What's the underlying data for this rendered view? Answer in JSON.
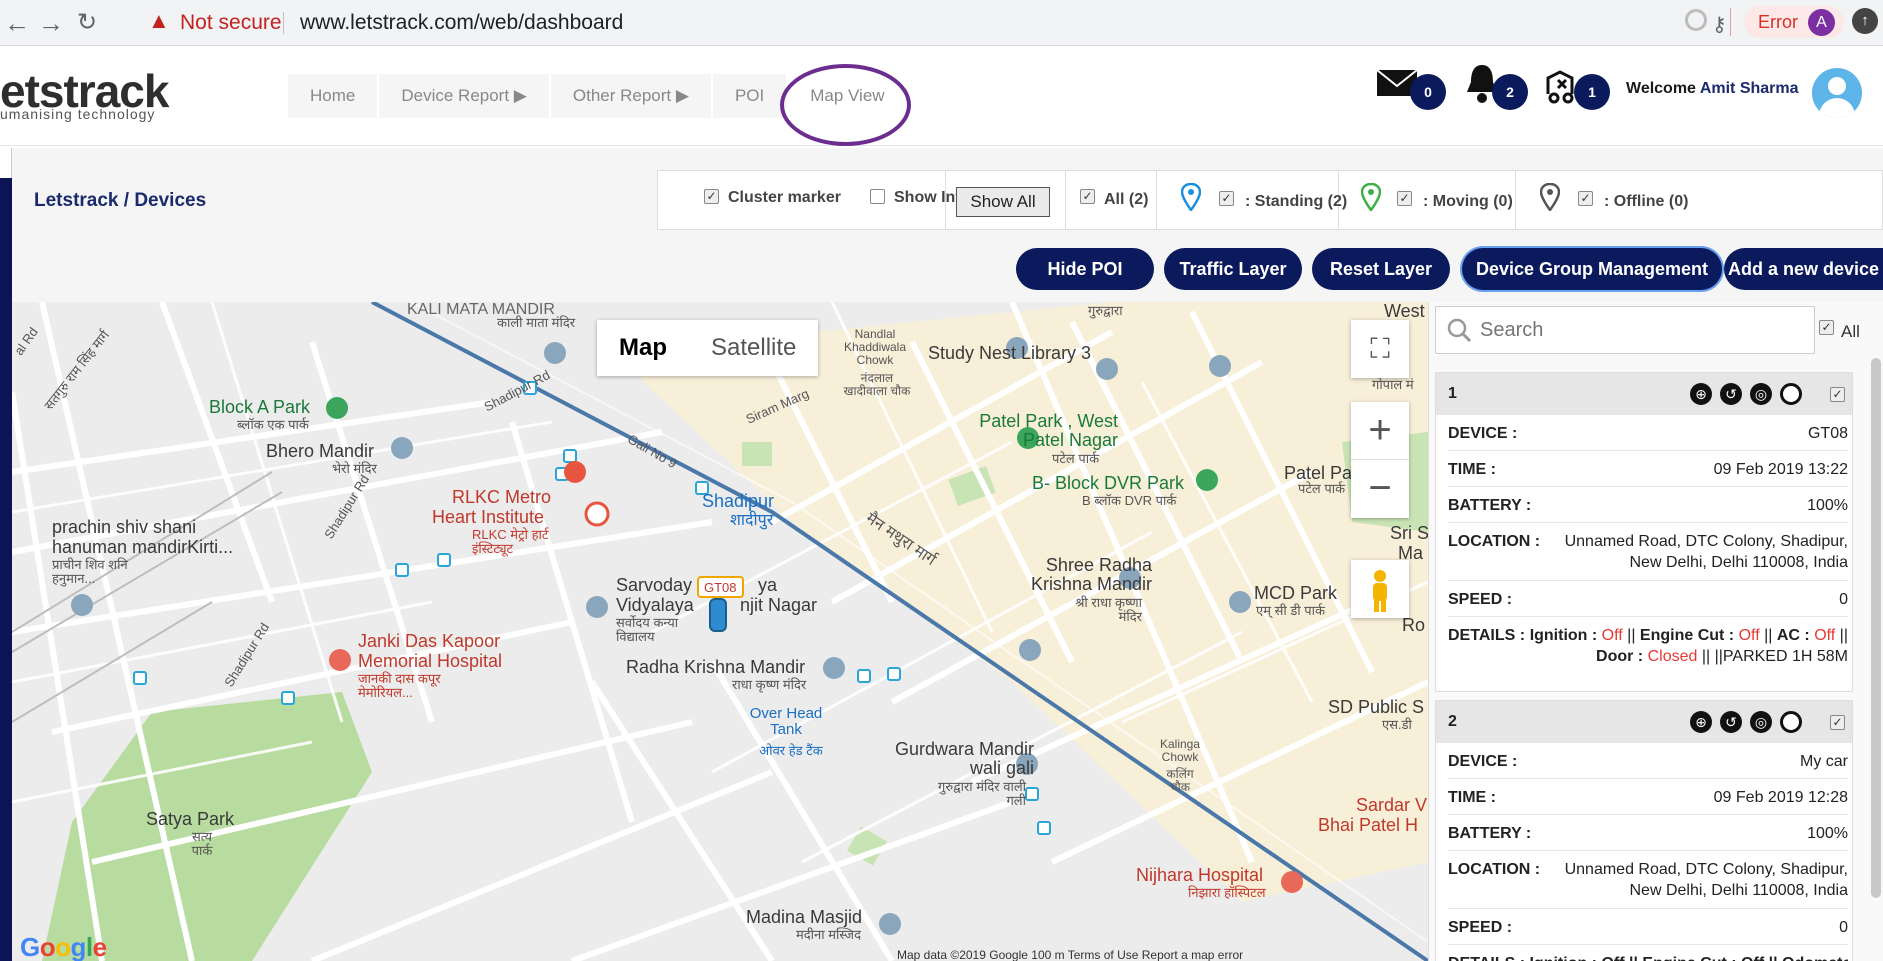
{
  "browser": {
    "not_secure": "Not secure",
    "url": "www.letstrack.com/web/dashboard",
    "error_label": "Error",
    "profile_initial": "A"
  },
  "header": {
    "logo": "etstrack",
    "tagline": "umanising technology",
    "nav": [
      "Home",
      "Device Report ▶",
      "Other Report ▶",
      "POI",
      "Map View"
    ],
    "mail_count": "0",
    "bell_count": "2",
    "alert_count": "1",
    "welcome_prefix": "Welcome",
    "user_name": "Amit Sharma"
  },
  "breadcrumb": "Letstrack / Devices",
  "filters": {
    "cluster_marker": "Cluster marker",
    "show_info": "Show Info",
    "show_all": "Show All",
    "all": "All (2)",
    "standing": ": Standing (2)",
    "moving": ": Moving (0)",
    "offline": ": Offline (0)"
  },
  "actions": [
    "Hide POI",
    "Traffic Layer",
    "Reset Layer",
    "Device Group Management",
    "Add a new device"
  ],
  "map": {
    "type_map": "Map",
    "type_satellite": "Satellite",
    "google": "Google",
    "footer": "Map data ©2019 Google   100 m            Terms of Use    Report a map error",
    "vehicle_label": "GT08",
    "places": {
      "kali_mata": "KALI MATA MANDIR",
      "kali_mata_hi": "काली माता मंदिर",
      "block_a_park": "Block A Park",
      "block_a_park_hi": "ब्लॉक एक पार्क",
      "bhero_mandir": "Bhero Mandir",
      "bhero_mandir_hi": "भेरो मंदिर",
      "rlkc1": "RLKC Metro",
      "rlkc2": "Heart Institute",
      "rlkc_hi": "RLKC मेट्रो हार्ट इंस्टिट्यूट",
      "prachin1": "prachin shiv shani",
      "prachin2": "hanuman mandirKirti...",
      "prachin_hi": "प्राचीन शिव शनि हनुमान...",
      "shadipur": "Shadipur",
      "shadipur_hi": "शादीपुर",
      "sarvoday1": "Sarvoday",
      "sarvoday2": "Vidyalaya",
      "ranjit_tail": "ya",
      "ranjit_nagar": "njit Nagar",
      "sarvoday_hi": "सर्वोदय कन्या विद्यालय",
      "janki1": "Janki Das Kapoor",
      "janki2": "Memorial Hospital",
      "janki_hi": "जानकी दास कपूर मेमोरियल...",
      "radha1": "Radha Krishna Mandir",
      "radha1_hi": "राधा कृष्ण मंदिर",
      "overhead": "Over Head Tank",
      "overhead_hi": "ओवर हेड टैंक",
      "gurudwara": "Gurdwara Mandir wali gali",
      "gurudwara_hi": "गुरुद्वारा मंदिर वाली गली",
      "satya": "Satya Park",
      "satya_hi": "सत्य पार्क",
      "madina": "Madina Masjid",
      "madina_hi": "मदीना मस्जिद",
      "nandlal": "Nandlal Khaddiwala Chowk",
      "nandlal_hi": "नंदलाल खादीवाला चौक",
      "study_nest": "Study Nest Library 3",
      "patel_park": "Patel Park , West Patel Nagar",
      "patel_park_hi": "पटेल पार्क",
      "bblock": "B- Block DVR Park",
      "bblock_hi": "B ब्लॉक DVR पार्क",
      "shree_radha": "Shree Radha Krishna Mandir",
      "shree_radha_hi": "श्री राधा कृष्णा मंदिर",
      "mcd_park": "MCD Park",
      "mcd_park_hi": "एम् सी डी पार्क",
      "kalinga": "Kalinga Chowk",
      "kalinga_hi": "कलिंग चौक",
      "nijhara": "Nijhara Hospital",
      "nijhara_hi": "निझारा हॉस्पिटल",
      "sd_public": "SD Public S",
      "sd_public_hi": "एस.डी",
      "sardar": "Sardar V",
      "bhai_patel": "Bhai Patel H",
      "patel_pa": "Patel Pa",
      "patel_pa_hi": "पटेल पार्क",
      "sri": "Sri S",
      "ma": "Ma",
      "ro": "Ro",
      "west": "West",
      "gopal": "गोपाल मं",
      "gurudwara_top": "गुरुद्वारा",
      "main_mathura": "मैन मथुरा मार्ग",
      "siram_marg": "Siram Marg",
      "gali9": "Gali No 9",
      "shadipur_rd1": "Shadipur Rd",
      "shadipur_rd2": "Shadipur Rd",
      "shadipur_rd3": "Shadipur Rd",
      "shadipur_rd4": "Shadipur Rd",
      "satguru": "सतगुरु राम सिंह मार्ग",
      "al_rd": "al Rd"
    }
  },
  "panel": {
    "search_placeholder": "Search",
    "all_label": "All",
    "devices": [
      {
        "index": "1",
        "device": "GT08",
        "time": "09 Feb 2019 13:22",
        "battery": "100%",
        "location": "Unnamed Road, DTC Colony, Shadipur, New Delhi, Delhi 110008, India",
        "speed": "0",
        "ignition": "Off",
        "engine_cut": "Off",
        "ac": "Off",
        "door": "Closed",
        "parked": "||PARKED 1H 58M"
      },
      {
        "index": "2",
        "device": "My car",
        "time": "09 Feb 2019 12:28",
        "battery": "100%",
        "location": "Unnamed Road, DTC Colony, Shadipur, New Delhi, Delhi 110008, India",
        "speed": "0",
        "details_partial": "DETAILS : Ignition : Off || Engine Cut : Off || Odometer"
      }
    ],
    "labels": {
      "device": "DEVICE :",
      "time": "TIME :",
      "battery": "BATTERY :",
      "location": "LOCATION :",
      "speed": "SPEED :",
      "details": "DETAILS :",
      "ignition": "Ignition :",
      "engine_cut": "Engine Cut :",
      "ac": "AC :",
      "door": "Door :"
    }
  },
  "colors": {
    "accent_navy": "#0b1a5c",
    "off_red": "#e53935",
    "highlight_ring": "#6b2d8f"
  }
}
